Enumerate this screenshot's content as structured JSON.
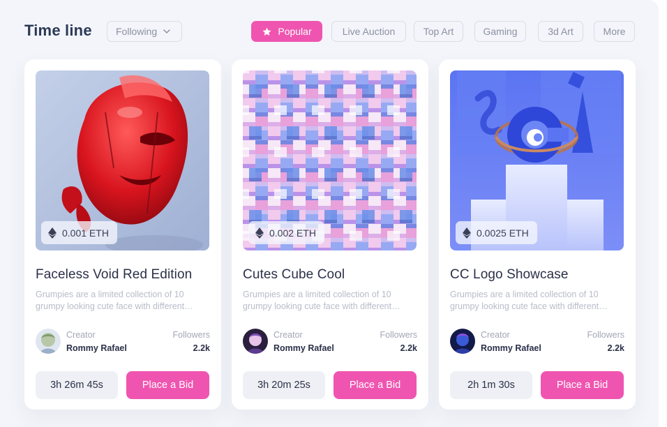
{
  "header": {
    "title": "Time line",
    "filter_label": "Following",
    "tags": [
      {
        "label": "Popular",
        "active": true
      },
      {
        "label": "Live Auction"
      },
      {
        "label": "Top Art"
      },
      {
        "label": "Gaming"
      },
      {
        "label": "3d Art"
      },
      {
        "label": "More"
      }
    ]
  },
  "cards": [
    {
      "name": "Faceless Void Red Edition",
      "price": "0.001 ETH",
      "description": "Grumpies are a limited collection of 10 grumpy looking cute face with different…",
      "creator_label": "Creator",
      "creator_name": "Rommy Rafael",
      "followers_label": "Followers",
      "followers_count": "2.2k",
      "timer": "3h 26m 45s",
      "bid_label": "Place a Bid"
    },
    {
      "name": "Cutes Cube Cool",
      "price": "0.002 ETH",
      "description": "Grumpies are a limited collection of 10 grumpy looking cute face with different…",
      "creator_label": "Creator",
      "creator_name": "Rommy Rafael",
      "followers_label": "Followers",
      "followers_count": "2.2k",
      "timer": "3h 20m 25s",
      "bid_label": "Place a Bid"
    },
    {
      "name": "CC Logo Showcase",
      "price": "0.0025 ETH",
      "description": "Grumpies are a limited collection of 10 grumpy looking cute face with different…",
      "creator_label": "Creator",
      "creator_name": "Rommy Rafael",
      "followers_label": "Followers",
      "followers_count": "2.2k",
      "timer": "2h 1m 30s",
      "bid_label": "Place a Bid"
    }
  ],
  "colors": {
    "accent": "#ef55b0",
    "title": "#2b3a55",
    "background": "#f4f5fa"
  }
}
